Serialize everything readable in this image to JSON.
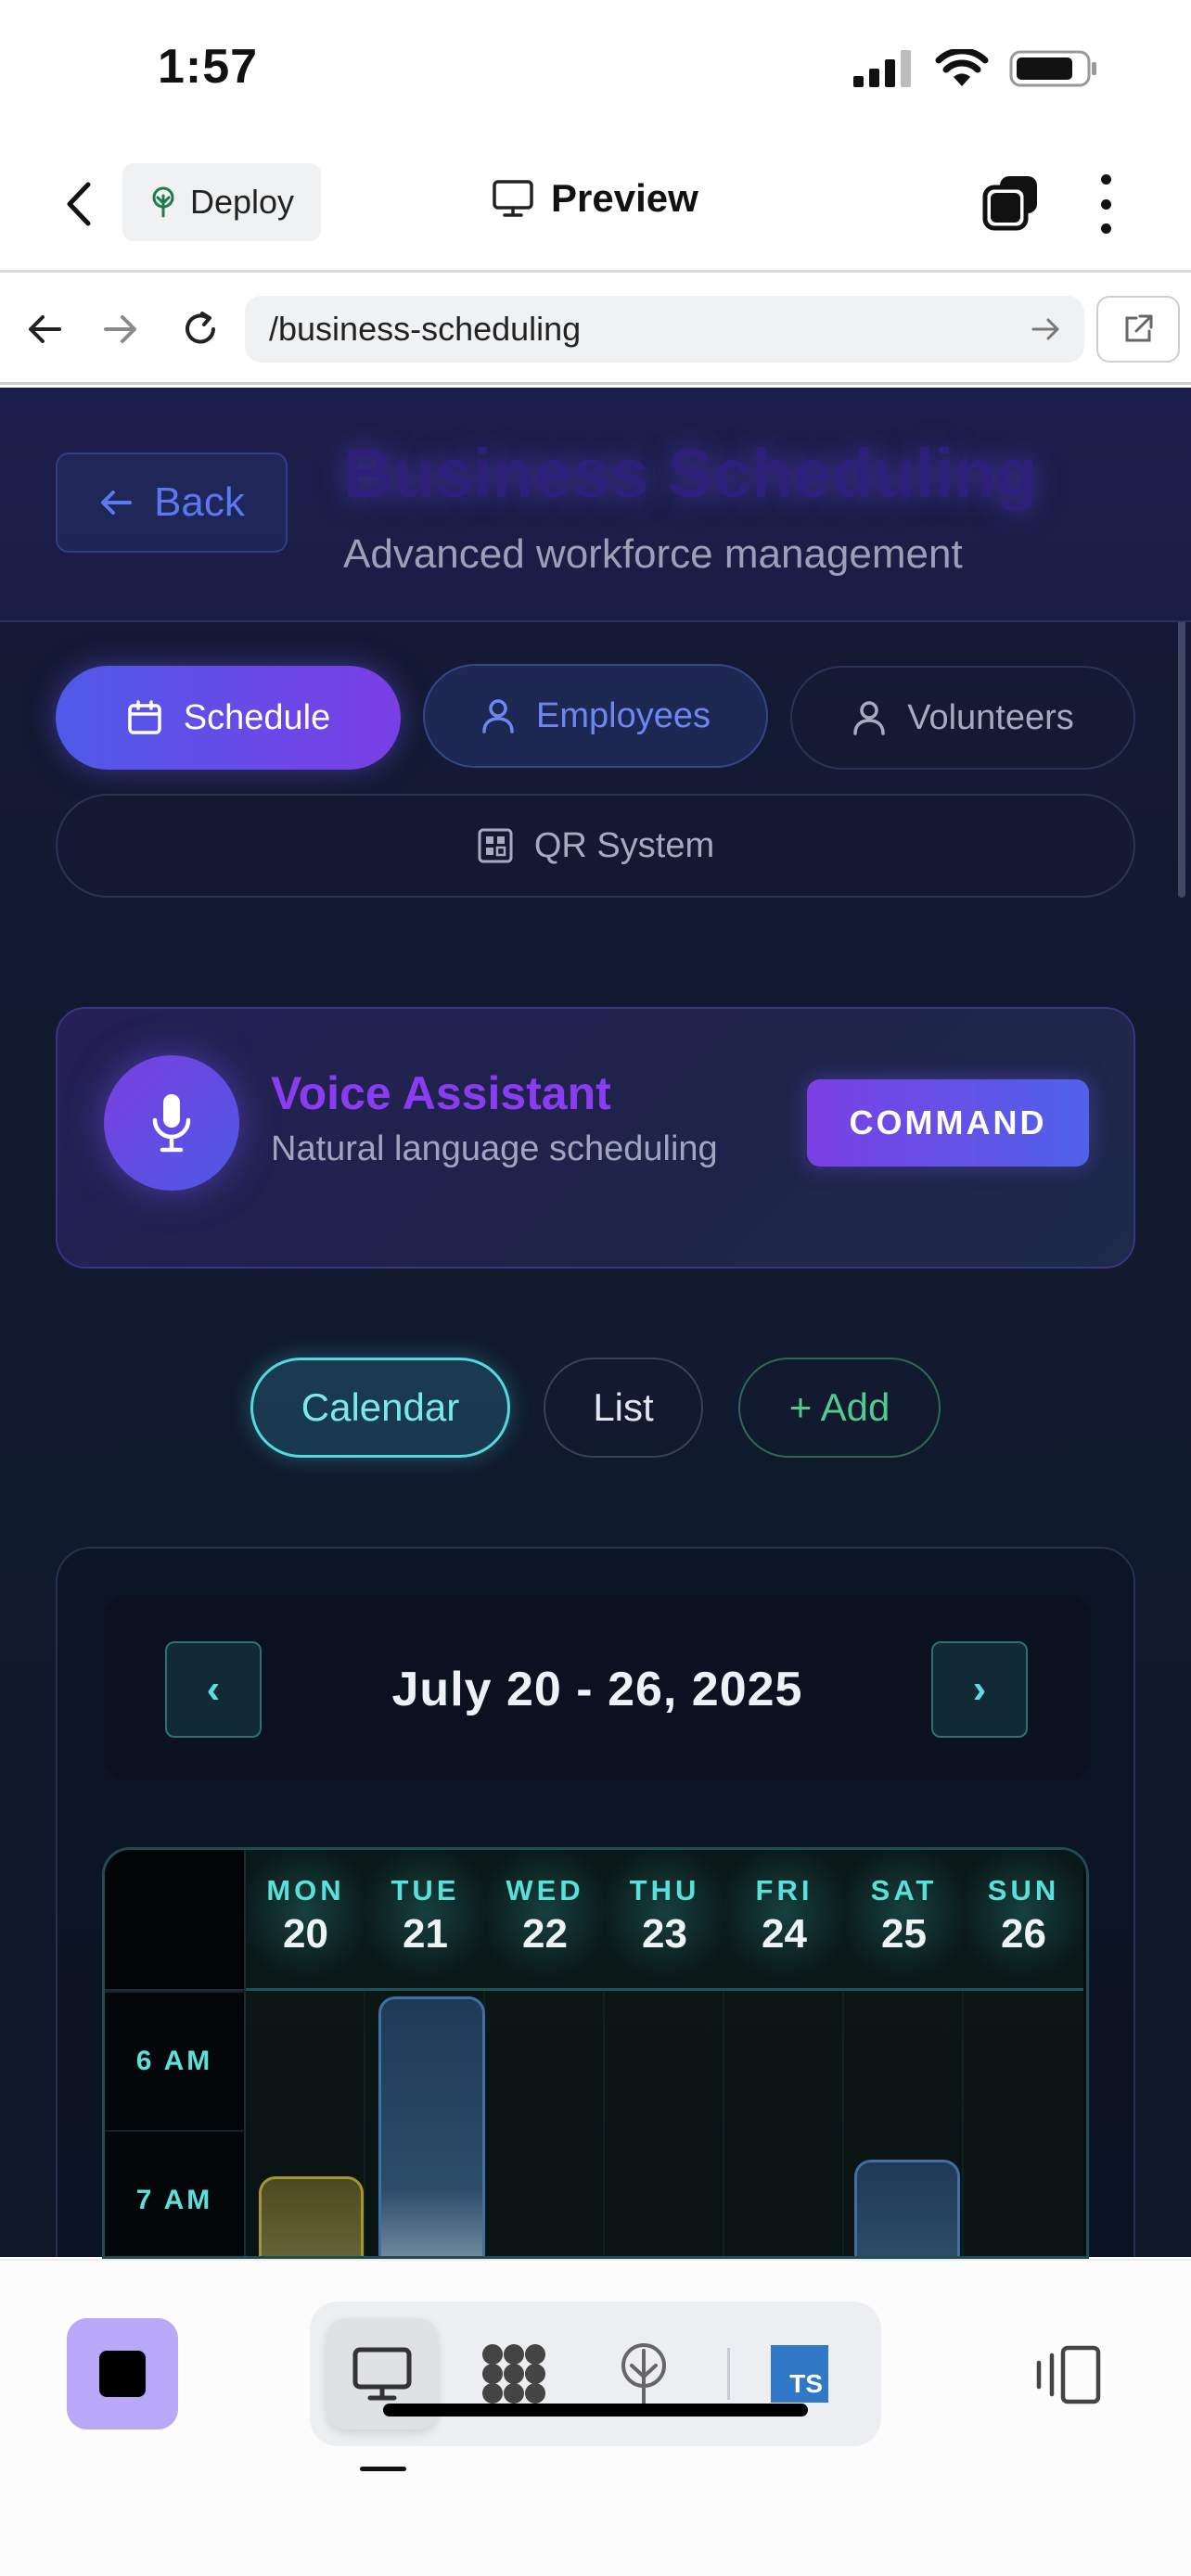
{
  "status_bar": {
    "time": "1:57"
  },
  "header": {
    "deploy_label": "Deploy",
    "preview_label": "Preview"
  },
  "browser": {
    "url": "/business-scheduling"
  },
  "page": {
    "back_label": "Back",
    "title": "Business Scheduling",
    "subtitle": "Advanced workforce management"
  },
  "tabs": [
    {
      "label": "Schedule",
      "icon": "calendar-icon"
    },
    {
      "label": "Employees",
      "icon": "user-icon"
    },
    {
      "label": "Volunteers",
      "icon": "user-icon"
    },
    {
      "label": "QR System",
      "icon": "qr-icon"
    }
  ],
  "voice": {
    "title": "Voice Assistant",
    "subtitle": "Natural language scheduling",
    "command_label": "COMMAND"
  },
  "views": {
    "calendar": "Calendar",
    "list": "List",
    "add": "+ Add"
  },
  "calendar": {
    "week_label": "July 20 - 26, 2025",
    "prev": "‹",
    "next": "›",
    "days": [
      {
        "name": "MON",
        "num": "20"
      },
      {
        "name": "TUE",
        "num": "21"
      },
      {
        "name": "WED",
        "num": "22"
      },
      {
        "name": "THU",
        "num": "23"
      },
      {
        "name": "FRI",
        "num": "24"
      },
      {
        "name": "SAT",
        "num": "25"
      },
      {
        "name": "SUN",
        "num": "26"
      }
    ],
    "times": [
      "6 AM",
      "7 AM"
    ]
  },
  "toolbar": {
    "ts_badge": "TS"
  },
  "colors": {
    "accent_purple": "#7a3ee6",
    "accent_blue": "#4f5ae8",
    "accent_cyan": "#52d9dc",
    "accent_green": "#54c98f"
  }
}
